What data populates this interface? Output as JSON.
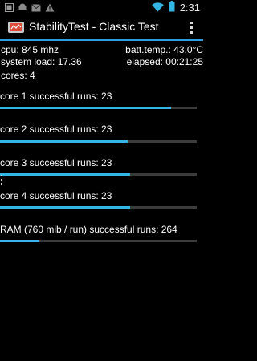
{
  "status_bar": {
    "time": "2:31",
    "icons": [
      "notification-icon",
      "android-icon",
      "email-icon",
      "warning-icon",
      "wifi-icon",
      "battery-icon"
    ]
  },
  "action_bar": {
    "title": "StabilityTest - Classic Test",
    "overflow_icon": "overflow-menu-icon"
  },
  "info": {
    "cpu": "cpu: 845 mhz",
    "batt_temp": "batt.temp.: 43.0°C",
    "system_load": "system load: 17.36",
    "elapsed": "elapsed: 00:21:25",
    "cores": "cores: 4"
  },
  "cores": [
    {
      "label": "core 1 successful runs: 23",
      "progress": 0.87
    },
    {
      "label": "core 2 successful runs: 23",
      "progress": 0.65
    },
    {
      "label": "core 3 successful runs: 23",
      "progress": 0.66
    },
    {
      "label": "core 4 successful runs: 23",
      "progress": 0.66
    }
  ],
  "ram": {
    "label": "RAM (760 mib / run) successful runs: 264",
    "progress": 0.2
  },
  "colors": {
    "accent": "#33b5e5",
    "divider": "#2e9fd8",
    "track": "#3b3b3b",
    "background": "#000000"
  }
}
